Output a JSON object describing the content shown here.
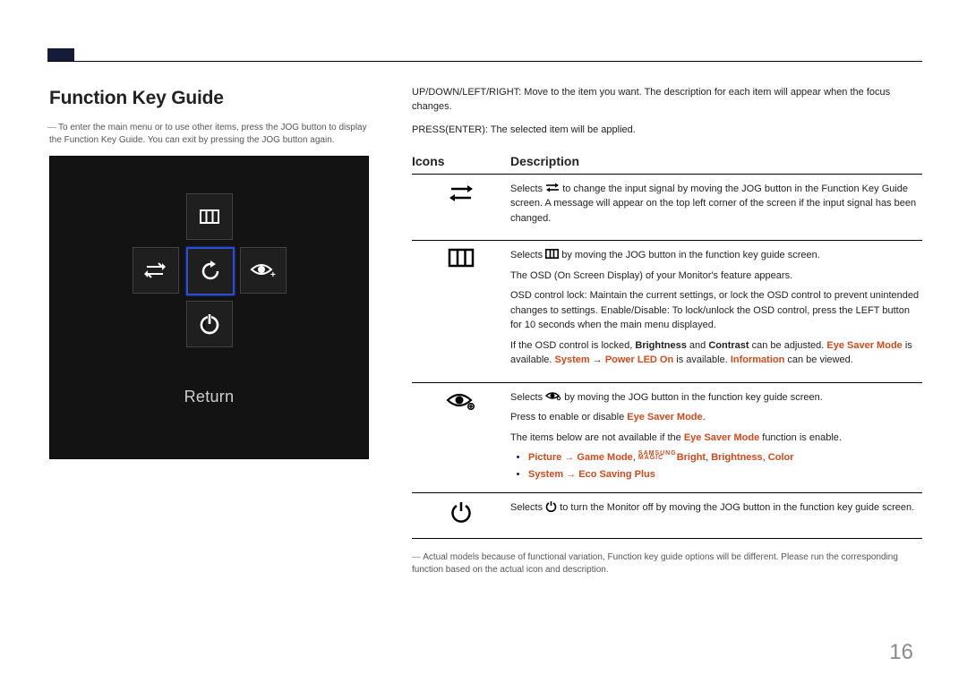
{
  "title": "Function Key Guide",
  "intro_note": "To enter the main menu or to use other items, press the JOG button to display the Function Key Guide. You can exit by pressing the JOG button again.",
  "panel_label": "Return",
  "intro_right": [
    "UP/DOWN/LEFT/RIGHT: Move to the item you want. The description for each item will appear when the focus changes.",
    "PRESS(ENTER): The selected item will be applied."
  ],
  "table_headers": {
    "icons": "Icons",
    "desc": "Description"
  },
  "rows": {
    "source": {
      "p1_a": "Selects ",
      "p1_b": " to change the input signal by moving the JOG button in the Function Key Guide screen. A message will appear on the top left corner of the screen if the input signal has been changed."
    },
    "menu": {
      "p1_a": "Selects ",
      "p1_b": " by moving the JOG button in the function key guide screen.",
      "p2": "The OSD (On Screen Display) of your Monitor's feature appears.",
      "p3": "OSD control lock: Maintain the current settings, or lock the OSD control to prevent unintended changes to settings. Enable/Disable: To lock/unlock the OSD control, press the LEFT button for 10 seconds when the main menu displayed.",
      "p4_a": "If the OSD control is locked, ",
      "p4_b": "Brightness",
      "p4_c": " and ",
      "p4_d": "Contrast",
      "p4_e": " can be adjusted. ",
      "p4_f": "Eye Saver Mode",
      "p4_g": " is available. ",
      "p4_h": "System",
      "p4_i": " → ",
      "p4_j": "Power LED On",
      "p4_k": " is available. ",
      "p4_l": "Information",
      "p4_m": " can be viewed."
    },
    "eye": {
      "p1_a": "Selects ",
      "p1_b": " by moving the JOG button in the function key guide screen.",
      "p2_a": "Press to enable or disable ",
      "p2_b": "Eye Saver Mode",
      "p2_c": ".",
      "p3_a": "The items below are not available if the ",
      "p3_b": "Eye Saver Mode",
      "p3_c": " function is enable.",
      "b1_a": "Picture",
      "b1_b": " → ",
      "b1_c": "Game Mode",
      "b1_d": ", ",
      "b1_mag1": "SAMSUNG",
      "b1_mag2": "MAGIC",
      "b1_e": "Bright",
      "b1_f": ", ",
      "b1_g": "Brightness",
      "b1_h": ", ",
      "b1_i": "Color",
      "b2_a": "System",
      "b2_b": " → ",
      "b2_c": "Eco Saving Plus"
    },
    "power": {
      "p1_a": "Selects ",
      "p1_b": " to turn the Monitor off by moving the JOG button in the function key guide screen."
    }
  },
  "footnote": "Actual models because of functional variation, Function key guide options will be different. Please run the corresponding function based on the actual icon and description.",
  "page_number": "16"
}
